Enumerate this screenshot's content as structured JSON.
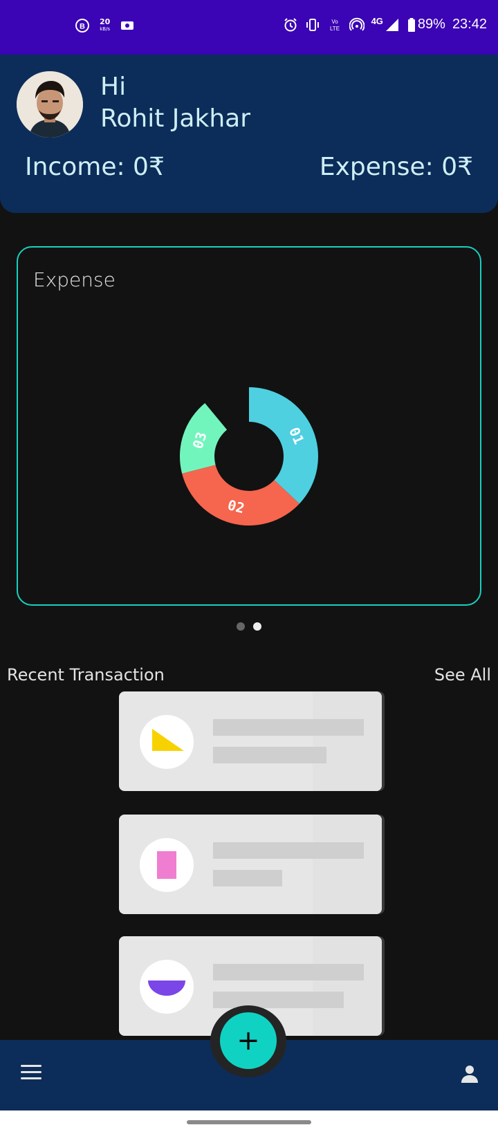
{
  "status_bar": {
    "net_speed_value": "20",
    "net_speed_unit": "kB/s",
    "network": "4G",
    "battery": "89%",
    "time": "23:42",
    "colors": {
      "background": "#3b04b4"
    }
  },
  "header": {
    "greeting": "Hi",
    "user_name": "Rohit Jakhar",
    "income_label": "Income: 0₹",
    "expense_label": "Expense: 0₹",
    "colors": {
      "background": "#0c2d59",
      "text": "#cfeef5"
    }
  },
  "chart_card": {
    "title": "Expense",
    "border_color": "#18d1c1"
  },
  "chart_data": {
    "type": "pie",
    "title": "Expense",
    "slices": [
      {
        "label": "01",
        "value": 37,
        "color": "#4ed0e0"
      },
      {
        "label": "02",
        "value": 34,
        "color": "#f6654d"
      },
      {
        "label": "03",
        "value": 18,
        "color": "#72f5bd"
      }
    ],
    "gap_value": 11
  },
  "pager": {
    "pages": 2,
    "active_index": 1
  },
  "recent": {
    "title": "Recent Transaction",
    "see_all": "See All",
    "placeholders": [
      {
        "icon": "triangle-icon",
        "color": "#f8d200"
      },
      {
        "icon": "rectangle-icon",
        "color": "#f07ed0"
      },
      {
        "icon": "semicircle-icon",
        "color": "#7a46e8"
      }
    ]
  },
  "bottom_nav": {
    "menu_icon": "hamburger-menu-icon",
    "profile_icon": "person-icon",
    "fab_label": "+",
    "colors": {
      "background": "#0c2d59",
      "fab": "#10d2c2"
    }
  }
}
